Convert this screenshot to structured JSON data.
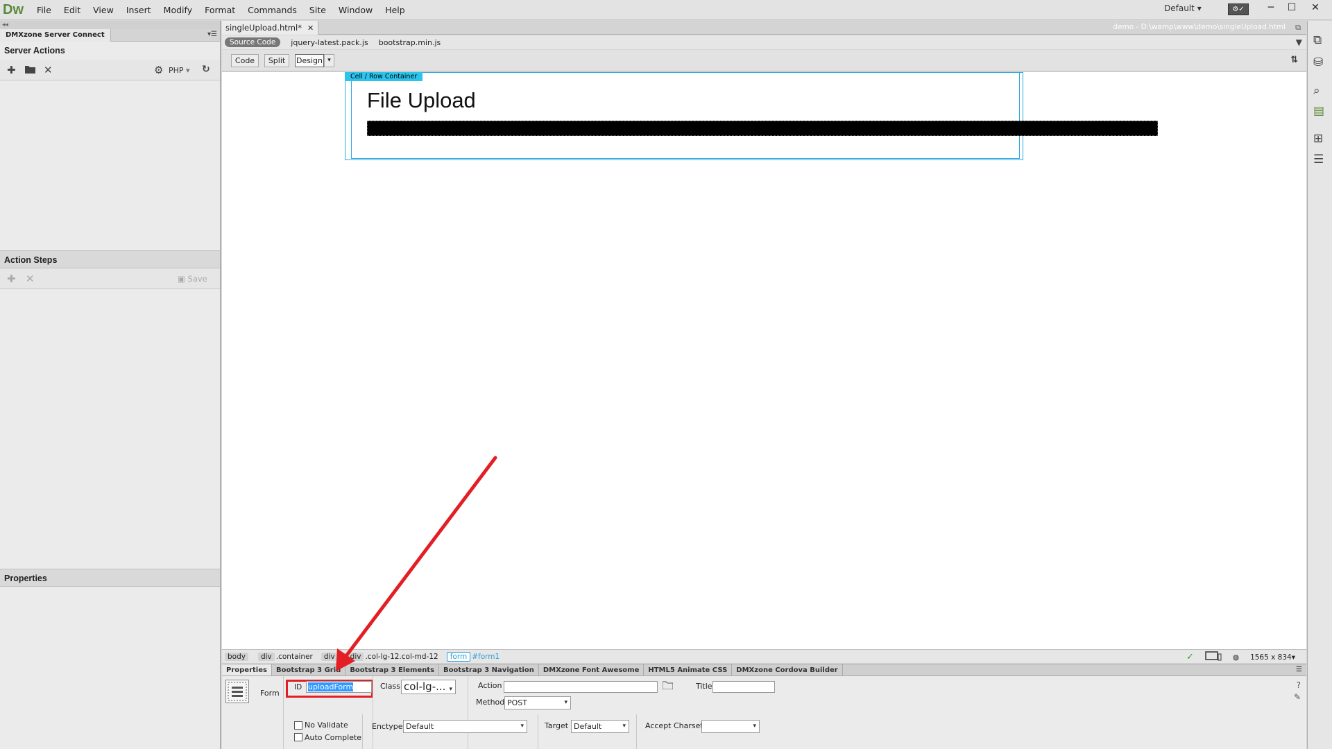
{
  "app": {
    "logo": "Dw",
    "menus": [
      "File",
      "Edit",
      "View",
      "Insert",
      "Modify",
      "Format",
      "Commands",
      "Site",
      "Window",
      "Help"
    ],
    "workspace": "Default",
    "window_buttons": [
      "─",
      "☐",
      "✕"
    ]
  },
  "left_panel": {
    "grip": "◂◂",
    "tab_title": "DMXzone Server Connect",
    "server_actions": {
      "title": "Server Actions",
      "language": "PHP"
    },
    "action_steps": {
      "title": "Action Steps",
      "save_label": "Save"
    },
    "properties_title": "Properties"
  },
  "document": {
    "tab_title": "singleUpload.html*",
    "path": "demo - D:\\wamp\\www\\demo\\singleUpload.html",
    "source_code_label": "Source Code",
    "related_files": [
      "jquery-latest.pack.js",
      "bootstrap.min.js"
    ],
    "views": [
      "Code",
      "Split",
      "Design"
    ],
    "active_view": "Design"
  },
  "canvas": {
    "container_label": "Cell / Row Container",
    "heading": "File Upload"
  },
  "tag_selector": {
    "tags": [
      {
        "tag": "body",
        "cls": ""
      },
      {
        "tag": "div",
        "cls": ".container"
      },
      {
        "tag": "div",
        "cls": ""
      },
      {
        "tag": "div",
        "cls": ".col-lg-12.col-md-12"
      },
      {
        "tag": "form",
        "cls": "#form1"
      }
    ],
    "screen_size": "1565 x 834"
  },
  "properties": {
    "tabs": [
      "Properties",
      "Bootstrap 3 Grid",
      "Bootstrap 3 Elements",
      "Bootstrap 3 Navigation",
      "DMXzone Font Awesome",
      "HTML5 Animate CSS",
      "DMXzone Cordova Builder"
    ],
    "element_type": "Form",
    "id_label": "ID",
    "id_value": "uploadForm",
    "class_label": "Class",
    "class_value": "col-lg-...",
    "action_label": "Action",
    "action_value": "",
    "title_label": "Title",
    "title_value": "",
    "method_label": "Method",
    "method_value": "POST",
    "no_validate_label": "No Validate",
    "auto_complete_label": "Auto Complete",
    "enctype_label": "Enctype",
    "enctype_value": "Default",
    "target_label": "Target",
    "target_value": "Default",
    "accept_charset_label": "Accept Charset",
    "accept_charset_value": ""
  },
  "colors": {
    "annotation": "#e31e24",
    "container_outline": "#2aa8e0",
    "logo": "#5a8a3a"
  }
}
